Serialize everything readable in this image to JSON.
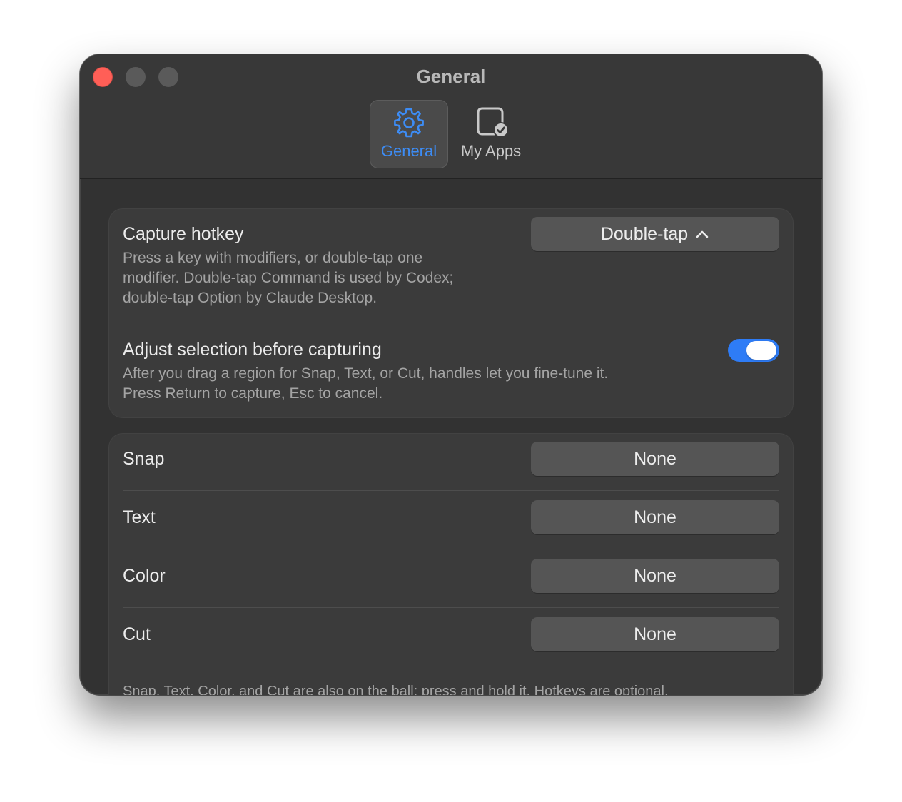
{
  "window": {
    "title": "General",
    "traffic_lights": {
      "close": "#ff5f57",
      "minimize": "#5a5a5a",
      "zoom": "#5a5a5a"
    }
  },
  "toolbar": {
    "tabs": [
      {
        "label": "General",
        "icon": "gear-icon",
        "selected": true
      },
      {
        "label": "My Apps",
        "icon": "app-checkmark-icon",
        "selected": false
      }
    ]
  },
  "capture": {
    "hotkey_title": "Capture hotkey",
    "hotkey_desc_lines": [
      "Press a key with modifiers, or double-tap one",
      "modifier. Double-tap Command is used by Codex;",
      "double-tap Option by Claude Desktop."
    ],
    "hotkey_value": "Double-tap",
    "hotkey_value_icon": "chevron-up-icon",
    "adjust_title": "Adjust selection before capturing",
    "adjust_desc_lines": [
      "After you drag a region for Snap, Text, or Cut, handles let you fine-tune it.",
      "Press Return to capture, Esc to cancel."
    ],
    "adjust_enabled": true
  },
  "shortcuts": {
    "items": [
      {
        "label": "Snap",
        "value": "None"
      },
      {
        "label": "Text",
        "value": "None"
      },
      {
        "label": "Color",
        "value": "None"
      },
      {
        "label": "Cut",
        "value": "None"
      }
    ],
    "footnote": "Snap, Text, Color, and Cut are also on the ball: press and hold it. Hotkeys are optional."
  },
  "colors": {
    "accent": "#3d8cf4",
    "toggle_on": "#2e7cf6",
    "window_bg": "#323232",
    "card_bg": "#3b3b3b",
    "button_bg": "#555555"
  }
}
